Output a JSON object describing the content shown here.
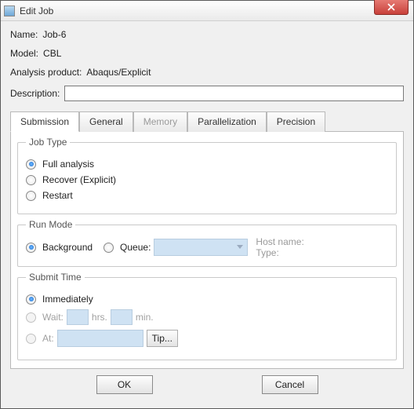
{
  "window": {
    "title": "Edit Job"
  },
  "fields": {
    "name_label": "Name:",
    "name_value": "Job-6",
    "model_label": "Model:",
    "model_value": "CBL",
    "product_label": "Analysis product:",
    "product_value": "Abaqus/Explicit",
    "description_label": "Description:",
    "description_value": ""
  },
  "tabs": {
    "submission": "Submission",
    "general": "General",
    "memory": "Memory",
    "parallel": "Parallelization",
    "precision": "Precision"
  },
  "jobtype": {
    "legend": "Job Type",
    "full": "Full analysis",
    "recover": "Recover (Explicit)",
    "restart": "Restart"
  },
  "runmode": {
    "legend": "Run Mode",
    "background": "Background",
    "queue": "Queue:",
    "host": "Host name:",
    "type": "Type:"
  },
  "submit": {
    "legend": "Submit Time",
    "immediately": "Immediately",
    "wait": "Wait:",
    "hrs": "hrs.",
    "min": "min.",
    "at": "At:",
    "tip": "Tip..."
  },
  "buttons": {
    "ok": "OK",
    "cancel": "Cancel"
  }
}
